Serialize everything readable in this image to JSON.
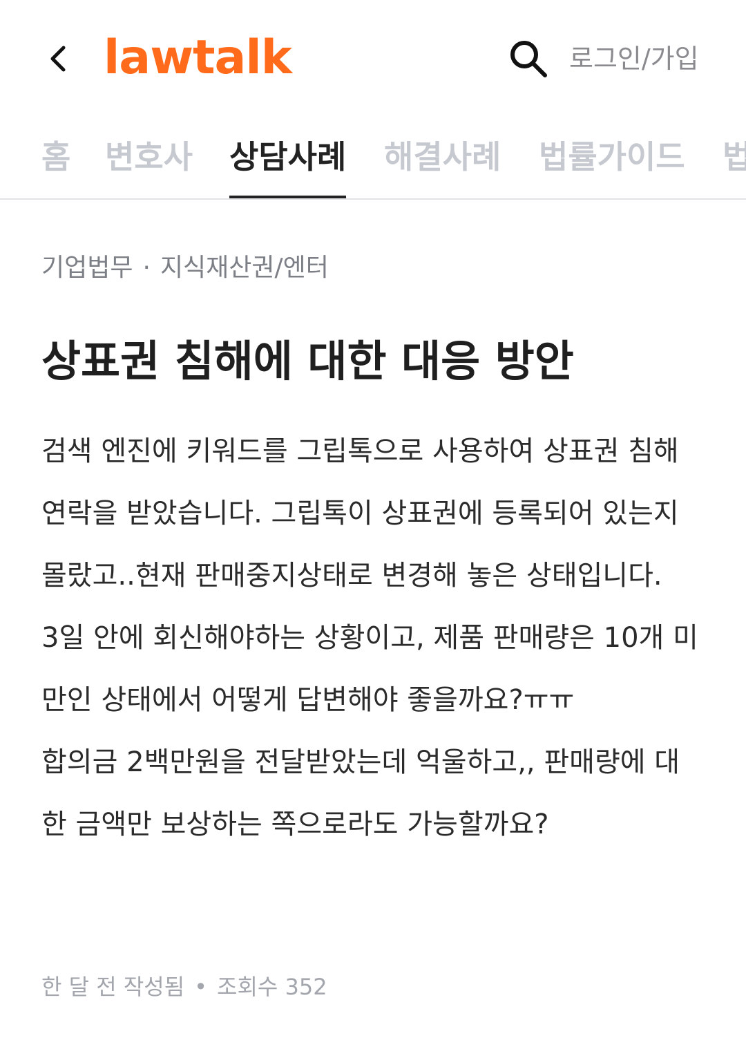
{
  "header": {
    "logo_text": "lawtalk",
    "login_label": "로그인/가입",
    "brand_color": "#ff6b1a",
    "back_icon": "chevron-left-icon",
    "search_icon": "search-icon"
  },
  "tabs": [
    {
      "label": "홈",
      "active": false
    },
    {
      "label": "변호사",
      "active": false
    },
    {
      "label": "상담사례",
      "active": true
    },
    {
      "label": "해결사례",
      "active": false
    },
    {
      "label": "법률가이드",
      "active": false
    },
    {
      "label": "법",
      "active": false
    }
  ],
  "breadcrumb": {
    "category": "기업법무",
    "separator": "·",
    "subcategory": "지식재산권/엔터"
  },
  "post": {
    "title": "상표권 침해에 대한 대응 방안",
    "paragraphs": [
      "검색 엔진에 키워드를 그립톡으로 사용하여 상표권 침해 연락을 받았습니다. 그립톡이 상표권에 등록되어 있는지 몰랐고..현재 판매중지상태로 변경해 놓은 상태입니다.",
      "3일 안에 회신해야하는 상황이고, 제품 판매량은 10개 미만인 상태에서 어떻게 답변해야 좋을까요?ㅠㅠ",
      "합의금 2백만원을 전달받았는데 억울하고,, 판매량에 대한 금액만 보상하는 쪽으로라도 가능할까요?"
    ],
    "meta": {
      "written": "한 달 전 작성됨",
      "separator": "•",
      "views": "조회수 352"
    }
  }
}
